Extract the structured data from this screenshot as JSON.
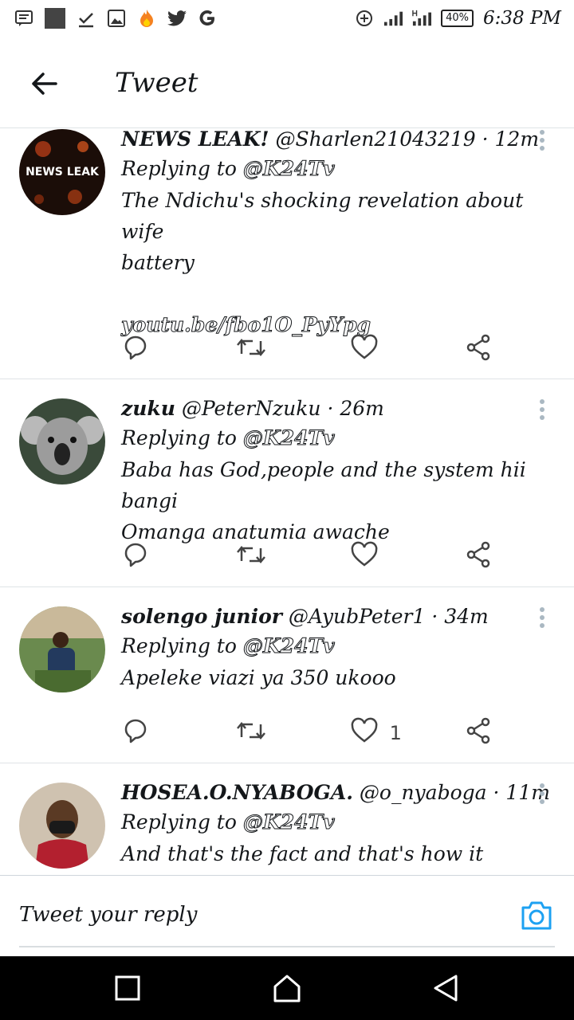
{
  "status_bar": {
    "time": "6:38 PM",
    "battery": "40%"
  },
  "header": {
    "title": "Tweet"
  },
  "tweets": [
    {
      "name": "NEWS LEAK!",
      "handle": "@Sharlen21043219",
      "time": "· 12m",
      "replying_prefix": "Replying to",
      "replying_to": "@K24Tv",
      "text_lines": [
        "The Ndichu's shocking revelation about wife",
        "battery"
      ],
      "link": "youtu.be/fbo1O_PyYpg",
      "avatar_text": "NEWS LEAK",
      "like_count": ""
    },
    {
      "name": "zuku",
      "handle": "@PeterNzuku",
      "time": "· 26m",
      "replying_prefix": "Replying to",
      "replying_to": "@K24Tv",
      "text_lines": [
        "Baba has God,people and the system hii bangi",
        "Omanga anatumia awache"
      ],
      "like_count": ""
    },
    {
      "name": "solengo junior",
      "handle": "@AyubPeter1",
      "time": "· 34m",
      "replying_prefix": "Replying to",
      "replying_to": "@K24Tv",
      "text_lines": [
        "Apeleke viazi ya 350 ukooo"
      ],
      "like_count": "1"
    },
    {
      "name": "HOSEA.O.NYABOGA.",
      "handle": "@o_nyaboga",
      "time": "· 11m",
      "replying_prefix": "Replying to",
      "replying_to": "@K24Tv",
      "text_lines": [
        "And that's the fact and that's how it goes..."
      ],
      "like_count": ""
    }
  ],
  "reply_bar": {
    "placeholder": "Tweet your reply"
  },
  "colors": {
    "accent": "#1da1f2",
    "divider": "#dfe3e6",
    "navbar": "#000000"
  }
}
